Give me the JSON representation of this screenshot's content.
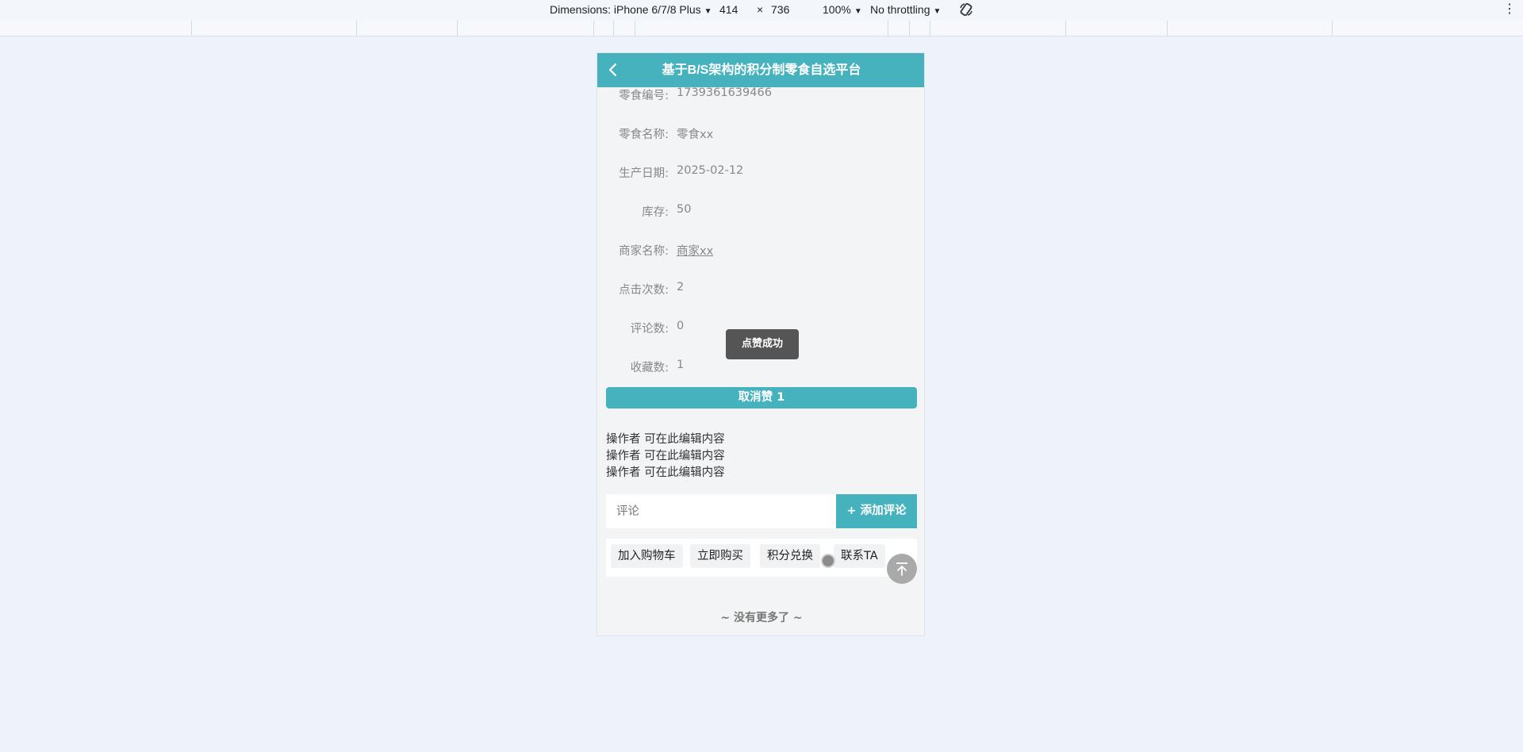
{
  "devtools": {
    "dimensions_label": "Dimensions: iPhone 6/7/8 Plus",
    "width": "414",
    "times": "×",
    "height": "736",
    "zoom": "100%",
    "throttling": "No throttling"
  },
  "header": {
    "title": "基于B/S架构的积分制零食自选平台"
  },
  "details": [
    {
      "label": "零食编号:",
      "value": "1739361639466"
    },
    {
      "label": "零食名称:",
      "value": "零食xx"
    },
    {
      "label": "生产日期:",
      "value": "2025-02-12"
    },
    {
      "label": "库存:",
      "value": "50"
    },
    {
      "label": "商家名称:",
      "value": "商家xx"
    },
    {
      "label": "点击次数:",
      "value": "2"
    },
    {
      "label": "评论数:",
      "value": "0"
    },
    {
      "label": "收藏数:",
      "value": "1"
    }
  ],
  "toast": "点赞成功",
  "like_button": "取消赞  1",
  "comments": [
    "操作者 可在此编辑内容",
    "操作者 可在此编辑内容",
    "操作者 可在此编辑内容"
  ],
  "comment_input": {
    "placeholder": "评论"
  },
  "add_comment": "+ 添加评论",
  "actions": [
    "加入购物车",
    "立即购买",
    "积分兑换",
    "联系TA"
  ],
  "footer": "~ 没有更多了 ~"
}
